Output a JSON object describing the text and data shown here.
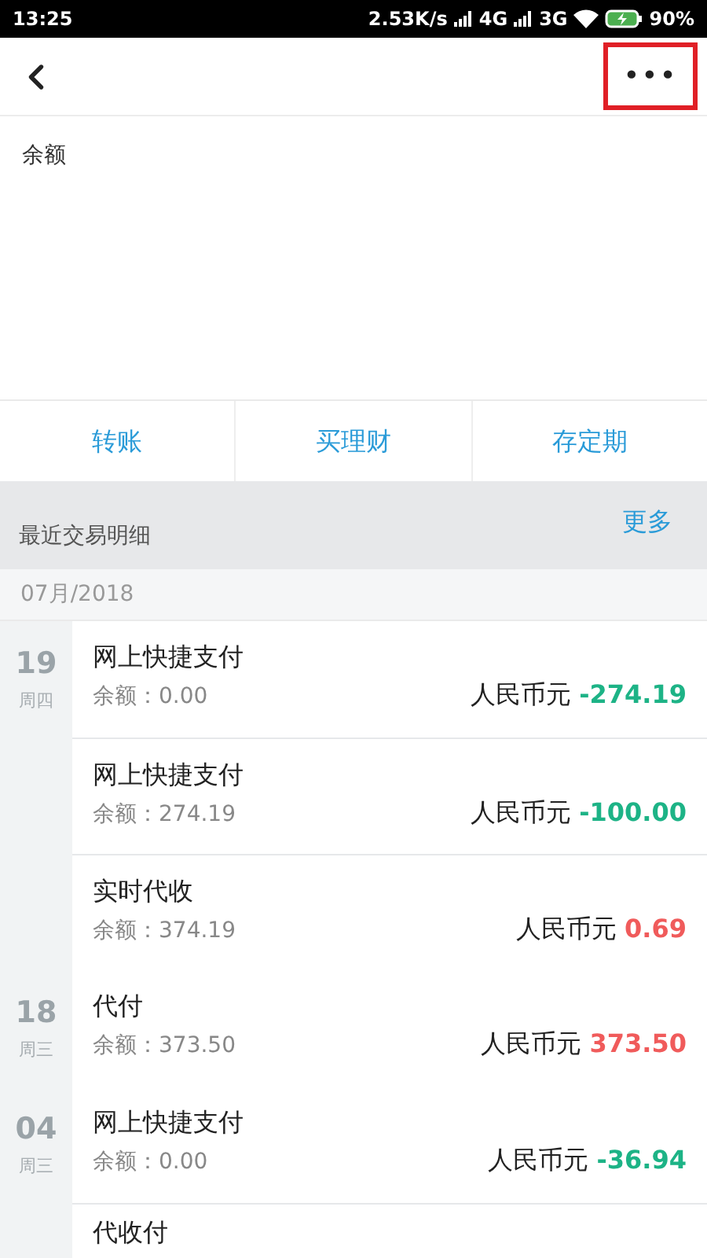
{
  "status_bar": {
    "time": "13:25",
    "speed": "2.53K/s",
    "network_1": "4G",
    "network_2": "3G",
    "battery": "90%"
  },
  "nav": {
    "more_button": {
      "label": "•••",
      "highlighted": true
    }
  },
  "balance": {
    "label": "余额"
  },
  "actions": [
    "转账",
    "买理财",
    "存定期"
  ],
  "section": {
    "title": "最近交易明细",
    "more": "更多"
  },
  "month": "07月/2018",
  "groups": [
    {
      "day": "19",
      "weekday": "周四",
      "items": [
        {
          "title": "网上快捷支付",
          "balance": "余额：0.00",
          "currency": "人民币元",
          "amount": "-274.19",
          "kind": "debit"
        },
        {
          "title": "网上快捷支付",
          "balance": "余额：274.19",
          "currency": "人民币元",
          "amount": "-100.00",
          "kind": "debit"
        },
        {
          "title": "实时代收",
          "balance": "余额：374.19",
          "currency": "人民币元",
          "amount": "0.69",
          "kind": "credit"
        }
      ]
    },
    {
      "day": "18",
      "weekday": "周三",
      "items": [
        {
          "title": "代付",
          "balance": "余额：373.50",
          "currency": "人民币元",
          "amount": "373.50",
          "kind": "credit"
        }
      ]
    },
    {
      "day": "04",
      "weekday": "周三",
      "items": [
        {
          "title": "网上快捷支付",
          "balance": "余额：0.00",
          "currency": "人民币元",
          "amount": "-36.94",
          "kind": "debit"
        },
        {
          "title": "代收付"
        }
      ]
    }
  ]
}
